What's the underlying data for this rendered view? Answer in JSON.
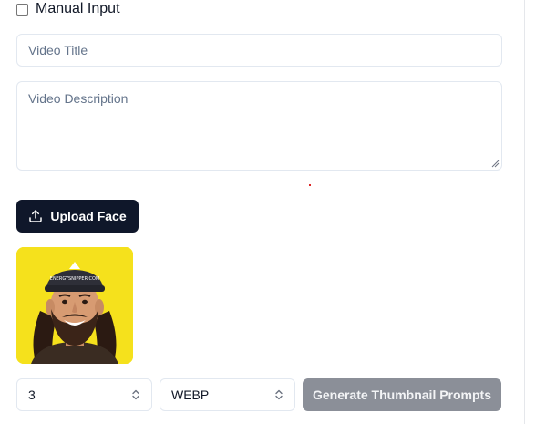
{
  "manual_input": {
    "label": "Manual Input",
    "checked": false
  },
  "video_title": {
    "placeholder": "Video Title",
    "value": ""
  },
  "video_description": {
    "placeholder": "Video Description",
    "value": ""
  },
  "upload_face": {
    "label": "Upload Face",
    "icon": "upload-icon"
  },
  "face_preview": {
    "background": "#f5e11c",
    "cap_text": "ENERGYSNIPPER.COM"
  },
  "controls": {
    "count_value": "3",
    "format_value": "WEBP",
    "generate_label": "Generate Thumbnail Prompts"
  },
  "colors": {
    "primary_button": "#0f172a",
    "disabled_button": "#8b8f98",
    "border": "#e2e8f0"
  }
}
